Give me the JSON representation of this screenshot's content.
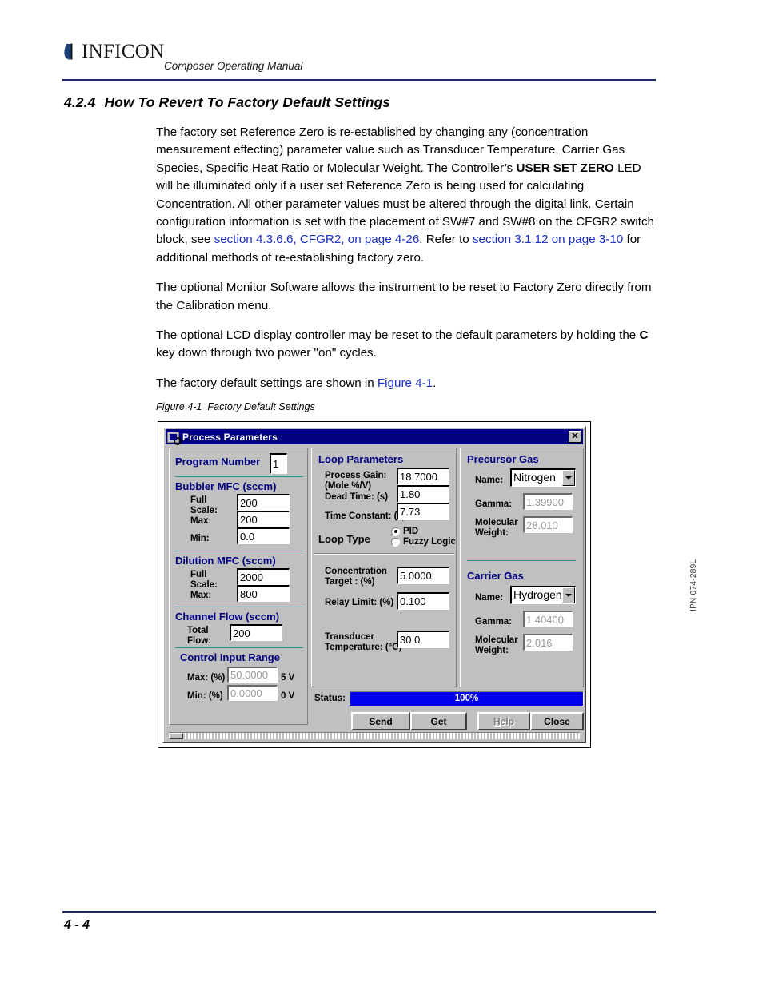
{
  "header": {
    "brand": "INFICON",
    "manual_title": "Composer Operating Manual"
  },
  "section": {
    "number": "4.2.4",
    "title": "How To Revert To Factory Default Settings"
  },
  "paragraphs": {
    "p1_a": "The factory set Reference Zero is re-established by changing any (concentration measurement effecting) parameter value such as Transducer Temperature, Carrier Gas Species, Specific Heat Ratio or Molecular Weight. The Controller’s ",
    "p1_bold": "USER SET ZERO",
    "p1_b": " LED will be illuminated only if a user set Reference Zero is being used for calculating Concentration. All other parameter values must be altered through the digital link. Certain configuration information is set with the placement of SW#7 and SW#8 on the CFGR2 switch block, see ",
    "p1_link1": "section 4.3.6.6, CFGR2, on page 4-26",
    "p1_c": ". Refer to ",
    "p1_link2": "section 3.1.12 on page 3-10",
    "p1_d": " for additional methods of re-establishing factory zero.",
    "p2": "The optional Monitor Software allows the instrument to be reset to Factory Zero directly from the Calibration menu.",
    "p3_a": "The optional LCD display controller may be reset to the default parameters by holding the ",
    "p3_bold": "C",
    "p3_b": " key down through two power \"on\" cycles.",
    "p4_a": "The factory default settings are shown in ",
    "p4_link": "Figure 4-1",
    "p4_b": "."
  },
  "figure": {
    "caption_number": "Figure 4-1",
    "caption_text": "Factory Default Settings"
  },
  "dialog": {
    "title": "Process Parameters",
    "close_label": "✕",
    "program": {
      "label": "Program Number",
      "value": "1"
    },
    "bubbler": {
      "title": "Bubbler MFC (sccm)",
      "full_scale_label": "Full Scale:",
      "full_scale_line1": "Full",
      "full_scale_line2": "Scale:",
      "full_scale_value": "200",
      "max_label": "Max:",
      "max_value": "200",
      "min_label": "Min:",
      "min_value": "0.0"
    },
    "dilution": {
      "title": "Dilution MFC (sccm)",
      "full_scale_line1": "Full",
      "full_scale_line2": "Scale:",
      "full_scale_value": "2000",
      "max_label": "Max:",
      "max_value": "800"
    },
    "channel_flow": {
      "title": "Channel Flow (sccm)",
      "total_line1": "Total",
      "total_line2": "Flow:",
      "total_value": "200"
    },
    "control_input_range": {
      "title": "Control Input Range",
      "max_label": "Max: (%)",
      "max_value": "50.0000",
      "max_volts": "5 V",
      "min_label": "Min: (%)",
      "min_value": "0.0000",
      "min_volts": "0 V"
    },
    "loop": {
      "title": "Loop Parameters",
      "process_gain_line1": "Process Gain:",
      "process_gain_line2": "(Mole %/V)",
      "process_gain_value": "18.7000",
      "dead_time_label": "Dead Time: (s)",
      "dead_time_value": "1.80",
      "time_constant_label": "Time Constant: (s)",
      "time_constant_value": "7.73",
      "loop_type_label": "Loop Type",
      "option_pid": "PID",
      "option_fuzzy": "Fuzzy Logic",
      "selected": "PID"
    },
    "process": {
      "conc_line1": "Concentration",
      "conc_line2": "Target : (%)",
      "conc_value": "5.0000",
      "relay_label": "Relay Limit: (%)",
      "relay_value": "0.100",
      "transducer_line1": "Transducer",
      "transducer_line2": "Temperature: (°C)",
      "transducer_value": "30.0"
    },
    "precursor_gas": {
      "title": "Precursor Gas",
      "name_label": "Name:",
      "name_value": "Nitrogen",
      "gamma_label": "Gamma:",
      "gamma_value": "1.39900",
      "mw_line1": "Molecular",
      "mw_line2": "Weight:",
      "mw_value": "28.010"
    },
    "carrier_gas": {
      "title": "Carrier Gas",
      "name_label": "Name:",
      "name_value": "Hydrogen",
      "gamma_label": "Gamma:",
      "gamma_value": "1.40400",
      "mw_line1": "Molecular",
      "mw_line2": "Weight:",
      "mw_value": "2.016"
    },
    "status": {
      "label": "Status:",
      "percent": "100%"
    },
    "buttons": {
      "send_mnemonic": "S",
      "send_rest": "end",
      "get_mnemonic": "G",
      "get_rest": "et",
      "help_mnemonic": "H",
      "help_rest": "elp",
      "close_mnemonic": "C",
      "close_rest": "lose"
    }
  },
  "side_code": "IPN 074-289L",
  "footer": {
    "page_number": "4 - 4"
  },
  "colors": {
    "brand_rule": "#1c2a63",
    "link": "#1a2fc4",
    "dialog_heading": "#000080",
    "titlebar": "#000080",
    "status_bar": "#0000ee",
    "teal_rule": "#2e8b8b"
  }
}
